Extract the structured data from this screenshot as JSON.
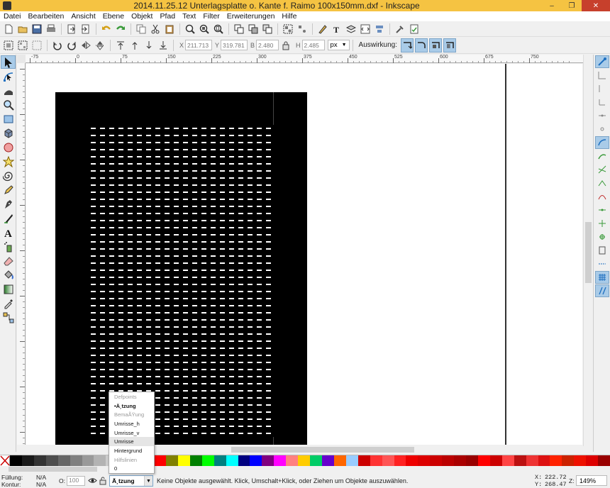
{
  "window": {
    "title": "2014.11.25.12 Unterlagsplatte o. Kante f. Raimo 100x150mm.dxf - Inkscape",
    "minimize": "–",
    "maximize": "❐",
    "close": "✕"
  },
  "menubar": {
    "items": [
      "Datei",
      "Bearbeiten",
      "Ansicht",
      "Ebene",
      "Objekt",
      "Pfad",
      "Text",
      "Filter",
      "Erweiterungen",
      "Hilfe"
    ]
  },
  "controls": {
    "x_label": "X",
    "x_value": "211.713",
    "y_label": "Y",
    "y_value": "319.781",
    "w_label": "B",
    "w_value": "2.480",
    "h_label": "H",
    "h_value": "2.485",
    "unit": "px",
    "auswirkung_label": "Auswirkung:"
  },
  "ruler": {
    "ticks": [
      "-75",
      "0",
      "75",
      "150",
      "225",
      "300",
      "375",
      "450",
      "525",
      "600",
      "675",
      "750"
    ]
  },
  "palette": {
    "colors": [
      "#000000",
      "#1a1a1a",
      "#333333",
      "#4d4d4d",
      "#666666",
      "#808080",
      "#999999",
      "#b3b3b3",
      "#cccccc",
      "#e6e6e6",
      "#ffffff",
      "#800000",
      "#ff0000",
      "#808000",
      "#ffff00",
      "#008000",
      "#00ff00",
      "#008080",
      "#00ffff",
      "#000080",
      "#0000ff",
      "#800080",
      "#ff00ff",
      "#ff8080",
      "#ffcc00",
      "#00cc66",
      "#6600cc",
      "#ff6600",
      "#99ccff",
      "#cc0000",
      "#ff3333",
      "#ff5555",
      "#ff2222",
      "#ee0000",
      "#dd0000",
      "#cc0000",
      "#bb0000",
      "#aa0000",
      "#990000",
      "#ff0000",
      "#cc0000",
      "#ff4444",
      "#bb1111",
      "#ee3333",
      "#dd1111",
      "#ff2200",
      "#cc2200",
      "#ee1100",
      "#dd0000",
      "#990000"
    ]
  },
  "status": {
    "fill_label": "Füllung:",
    "fill_value": "N/A",
    "stroke_label": "Kontur:",
    "stroke_value": "N/A",
    "opacity_label": "O:",
    "opacity_value": "100",
    "current_layer": "Ä¸tzung",
    "message": "Keine Objekte ausgewählt. Klick, Umschalt+Klick, oder Ziehen um Objekte auszuwählen.",
    "coord_x_label": "X:",
    "coord_x_value": "222.72",
    "coord_y_label": "Y:",
    "coord_y_value": "268.47",
    "zoom_label": "Z:",
    "zoom_value": "149%"
  },
  "layer_dropdown": {
    "items": [
      {
        "label": "Defpoints",
        "style": "dim"
      },
      {
        "label": "•Ä¸tzung",
        "style": "bold"
      },
      {
        "label": "BemaÃŸung",
        "style": "dim"
      },
      {
        "label": "Umrisse_h",
        "style": ""
      },
      {
        "label": "Umrisse_v",
        "style": ""
      },
      {
        "label": "Umrisse",
        "style": "hover"
      },
      {
        "label": "Hintergrund",
        "style": ""
      },
      {
        "label": "Hilfslinien",
        "style": "dim"
      },
      {
        "label": "0",
        "style": ""
      }
    ]
  }
}
